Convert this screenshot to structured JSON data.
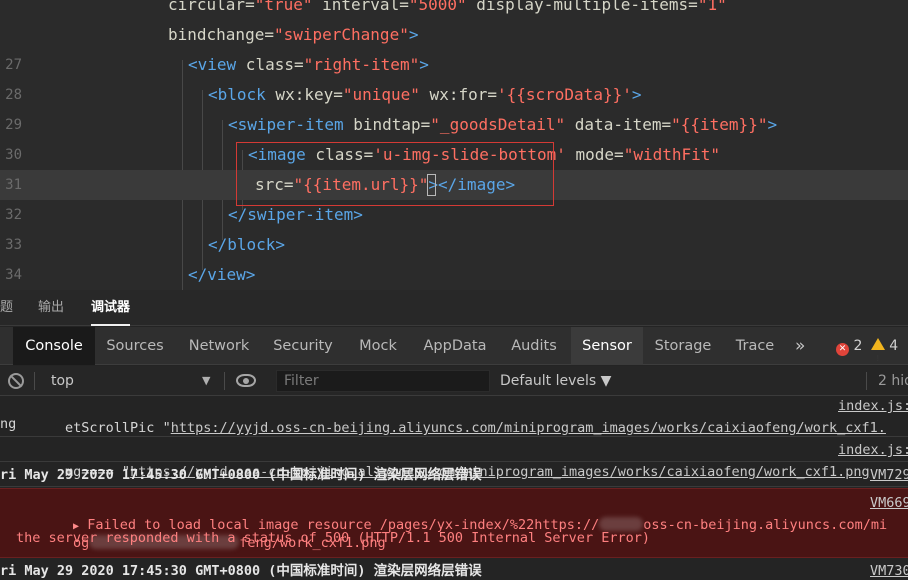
{
  "editor": {
    "lines": [
      {
        "no": "",
        "segments": [
          [
            "attr",
            "circular="
          ],
          [
            "str",
            "\"true\""
          ],
          [
            "attr",
            " interval="
          ],
          [
            "str",
            "\"5000\""
          ],
          [
            "attr",
            " display-multiple-items="
          ],
          [
            "str",
            "\"1\""
          ]
        ]
      },
      {
        "no": "",
        "segments": [
          [
            "attr",
            "bindchange="
          ],
          [
            "str",
            "\"swiperChange\""
          ],
          [
            "tag",
            ">"
          ]
        ]
      },
      {
        "no": "27",
        "segments": [
          [
            "tag",
            "<view"
          ],
          [
            "attr",
            " class="
          ],
          [
            "str",
            "\"right-item\""
          ],
          [
            "tag",
            ">"
          ]
        ]
      },
      {
        "no": "28",
        "segments": [
          [
            "tag",
            "<block"
          ],
          [
            "attr",
            " wx:key="
          ],
          [
            "str",
            "\"unique\""
          ],
          [
            "attr",
            " wx:for="
          ],
          [
            "str",
            "'{{scroData}}'"
          ],
          [
            "tag",
            ">"
          ]
        ]
      },
      {
        "no": "29",
        "segments": [
          [
            "tag",
            "<swiper-item"
          ],
          [
            "attr",
            " bindtap="
          ],
          [
            "str",
            "\"_goodsDetail\""
          ],
          [
            "attr",
            " data-item="
          ],
          [
            "str",
            "\"{{item}}\""
          ],
          [
            "tag",
            ">"
          ]
        ]
      },
      {
        "no": "30",
        "segments": [
          [
            "tag",
            "<image"
          ],
          [
            "attr",
            " class="
          ],
          [
            "str",
            "'u-img-slide-bottom'"
          ],
          [
            "attr",
            " mode="
          ],
          [
            "str",
            "\"widthFit\""
          ]
        ]
      },
      {
        "no": "31",
        "segments": [
          [
            "attr",
            "src="
          ],
          [
            "str",
            "\"{{item.url}}\""
          ],
          [
            "tag",
            ">"
          ],
          [
            "tag",
            "</image>"
          ]
        ]
      },
      {
        "no": "32",
        "segments": [
          [
            "tag",
            "</swiper-item>"
          ]
        ]
      },
      {
        "no": "33",
        "segments": [
          [
            "tag",
            "</block>"
          ]
        ]
      },
      {
        "no": "34",
        "segments": [
          [
            "tag",
            "</view>"
          ]
        ]
      }
    ]
  },
  "devtools": {
    "outer_tabs": [
      {
        "label": "题",
        "active": false
      },
      {
        "label": "输出",
        "active": false
      },
      {
        "label": "调试器",
        "active": true
      }
    ],
    "panel_tabs": [
      {
        "label": "Console",
        "state": "active"
      },
      {
        "label": "Sources",
        "state": ""
      },
      {
        "label": "Network",
        "state": ""
      },
      {
        "label": "Security",
        "state": ""
      },
      {
        "label": "Mock",
        "state": ""
      },
      {
        "label": "AppData",
        "state": ""
      },
      {
        "label": "Audits",
        "state": ""
      },
      {
        "label": "Sensor",
        "state": "alt"
      },
      {
        "label": "Storage",
        "state": ""
      },
      {
        "label": "Trace",
        "state": ""
      }
    ],
    "more_label": "»",
    "error_count": "2",
    "warning_count": "4",
    "context_label": "top",
    "context_arrow": "▼",
    "filter_placeholder": "Filter",
    "levels_label": "Default levels ▼",
    "hidden_label": "2 hid",
    "console": {
      "row1_text": "etScrollPic \"",
      "row1_link": "https://yyjd.oss-cn-beijing.aliyuncs.com/miniprogram_images/works/caixiaofeng/work_cxf1.",
      "row1_source": "index.js:",
      "row1_cont": "ng",
      "row2_text": "mg==== \"",
      "row2_link": "https://yyjd.oss-cn-beijing.aliyuncs.com/miniprogram_images/works/caixiaofeng/work_cxf1.png",
      "row2_source": "index.js:",
      "row3_text": "ri May 29 2020 17:45:30 GMT+0800 (中国标准时间) 渲染层网络层错误",
      "row3_source": "VM729",
      "err_arrow": "▶",
      "err_line1a": "Failed to load local image resource /pages/yx-index/%22https://",
      "err_line1b": "oss-cn-beijing.aliyuncs.com/mi",
      "err_line2a": "og",
      "err_line2b": "feng/work_cxf1.png",
      "err_line3": "the server responded with a status of 500 (HTTP/1.1 500 Internal Server Error)",
      "err_source": "VM669",
      "row5_text": "ri May 29 2020 17:45:30 GMT+0800 (中国标准时间) 渲染层网络层错误",
      "row5_source": "VM730"
    }
  }
}
